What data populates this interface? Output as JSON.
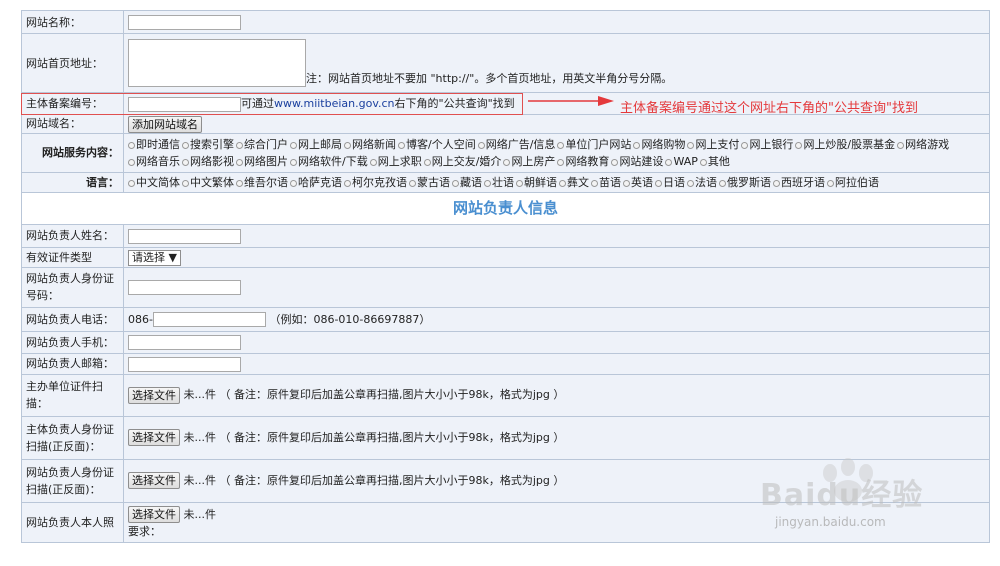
{
  "fields": {
    "site_name": {
      "label": "网站名称："
    },
    "homepage": {
      "label": "网站首页地址：",
      "note": "注：网站首页地址不要加 \"http://\"。多个首页地址，用英文半角分号分隔。"
    },
    "record_no": {
      "label": "主体备案编号：",
      "hint_pre": "可通过",
      "hint_link": "www.miitbeian.gov.cn",
      "hint_post": "右下角的\"公共查询\"找到"
    },
    "domain": {
      "label": "网站域名：",
      "button": "添加网站域名"
    },
    "services": {
      "label": "网站服务内容：",
      "options": [
        "即时通信",
        "搜索引擎",
        "综合门户",
        "网上邮局",
        "网络新闻",
        "博客/个人空间",
        "网络广告/信息",
        "单位门户网站",
        "网络购物",
        "网上支付",
        "网上银行",
        "网上炒股/股票基金",
        "网络游戏",
        "网络音乐",
        "网络影视",
        "网络图片",
        "网络软件/下载",
        "网上求职",
        "网上交友/婚介",
        "网上房产",
        "网络教育",
        "网站建设",
        "WAP",
        "其他"
      ]
    },
    "language": {
      "label": "语言：",
      "options": [
        "中文简体",
        "中文繁体",
        "维吾尔语",
        "哈萨克语",
        "柯尔克孜语",
        "蒙古语",
        "藏语",
        "壮语",
        "朝鲜语",
        "彝文",
        "苗语",
        "英语",
        "日语",
        "法语",
        "俄罗斯语",
        "西班牙语",
        "阿拉伯语"
      ]
    }
  },
  "section_title": "网站负责人信息",
  "person": {
    "name": {
      "label": "网站负责人姓名："
    },
    "id_type": {
      "label": "有效证件类型",
      "selected": "请选择"
    },
    "id_no": {
      "label": "网站负责人身份证号码："
    },
    "phone": {
      "label": "网站负责人电话：",
      "prefix": "086-",
      "example": "（例如：086-010-86697887）"
    },
    "mobile": {
      "label": "网站负责人手机："
    },
    "email": {
      "label": "网站负责人邮箱："
    },
    "org_scan": {
      "label": "主办单位证件扫描："
    },
    "subject_id_scan": {
      "label": "主体负责人身份证扫描(正反面)："
    },
    "site_id_scan": {
      "label": "网站负责人身份证扫描(正反面)："
    },
    "photo": {
      "label": "网站负责人本人照",
      "req": "要求："
    }
  },
  "file": {
    "button": "选择文件",
    "status": "未...件",
    "note": "（ 备注：原件复印后加盖公章再扫描,图片大小小于98k，格式为jpg ）"
  },
  "annotation": {
    "text": "主体备案编号通过这个网址右下角的\"公共查询\"找到",
    "color": "#e4393c"
  },
  "watermark": {
    "brand": "Baidu经验",
    "url": "jingyan.baidu.com"
  }
}
